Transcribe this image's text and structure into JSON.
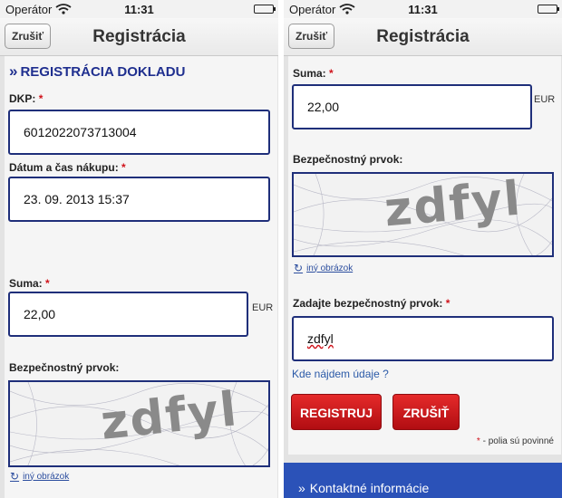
{
  "status": {
    "carrier": "Operátor",
    "time": "11:31"
  },
  "nav": {
    "cancel_label": "Zrušiť",
    "title": "Registrácia"
  },
  "form": {
    "section_title": "REGISTRÁCIA DOKLADU",
    "dkp_label": "DKP:",
    "dkp_value": "6012022073713004",
    "date_label": "Dátum a čas nákupu:",
    "date_value": "23. 09. 2013 15:37",
    "amount_label": "Suma:",
    "amount_value": "22,00",
    "currency": "EUR",
    "security_label": "Bezpečnostný prvok:",
    "captcha_text": "zdfyl",
    "other_image_link": "iný obrázok",
    "enter_security_label": "Zadajte bezpečnostný prvok:",
    "security_input_value": "zdfyl",
    "help_link": "Kde nájdem údaje ?",
    "register_button": "REGISTRUJ",
    "cancel_button": "ZRUŠIŤ",
    "required_asterisk": "*",
    "required_note": "- polia sú povinné"
  },
  "footer": {
    "arrow": "»",
    "label": "Kontaktné informácie"
  }
}
